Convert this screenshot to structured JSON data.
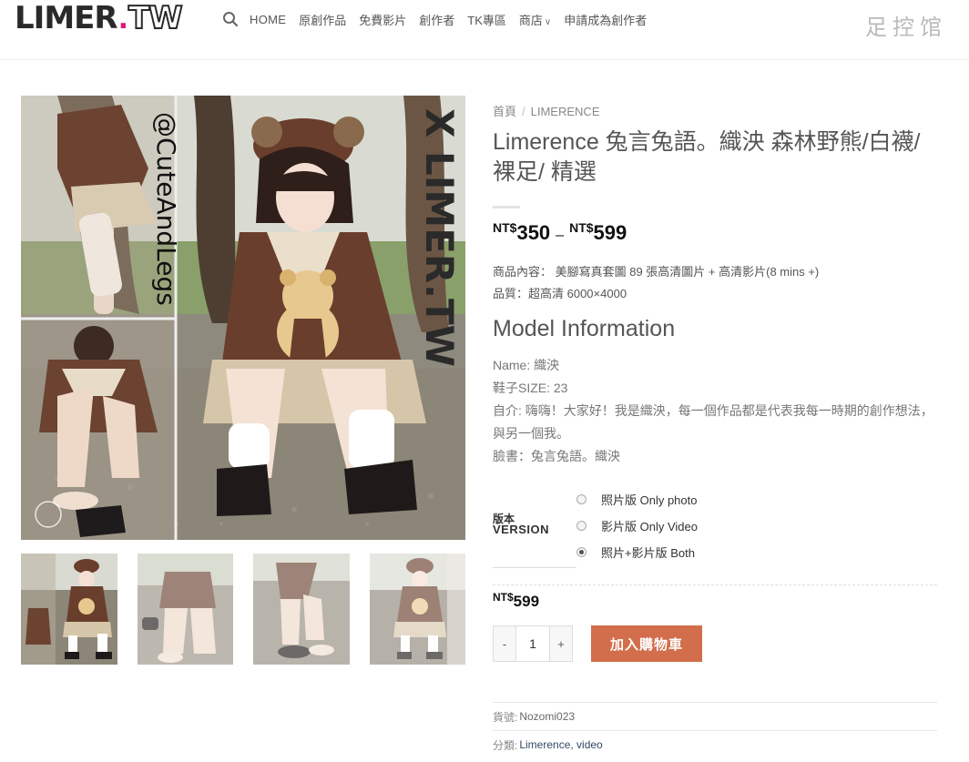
{
  "header": {
    "logo_left": "LIMER",
    "logo_dot": ".",
    "logo_right": "TW",
    "nav": [
      "HOME",
      "原創作品",
      "免費影片",
      "創作者",
      "TK專區",
      "商店",
      "申請成為創作者"
    ],
    "shop_chevron": "chevron-down-icon",
    "brand_right": "足控馆"
  },
  "gallery": {
    "main_overlay_handle": "@CuteAndLegs",
    "main_overlay_watermark": "X LIMER.TW",
    "thumbnail_count": 4
  },
  "product": {
    "breadcrumb": [
      "首頁",
      "LIMERENCE"
    ],
    "breadcrumb_sep": "/",
    "title": "Limerence 兔言兔語。織泱 森林野熊/白襪/裸足/ 精選",
    "price_min_currency": "NT$",
    "price_min": "350",
    "price_dash": "–",
    "price_max_currency": "NT$",
    "price_max": "599",
    "desc_line1": "商品內容： 美腳寫真套圖 89 張高清圖片 + 高清影片(8 mins +)",
    "desc_line2": "品質：超高清 6000×4000",
    "model_heading": "Model Information",
    "model_name": "Name: 織泱",
    "model_shoe": "鞋子SIZE: 23",
    "model_intro": "自介: 嗨嗨！大家好！我是織泱，每一個作品都是代表我每一時期的創作想法，與另一個我。",
    "model_facebook": "臉書：兔言兔語。織泱"
  },
  "variation": {
    "label_top": "版本",
    "label_bottom": "VERSION",
    "options": [
      "照片版 Only photo",
      "影片版 Only Video",
      "照片+影片版 Both"
    ],
    "selected_index": 2
  },
  "selected_price": {
    "currency": "NT$",
    "value": "599"
  },
  "cart": {
    "minus": "-",
    "quantity": "1",
    "plus": "+",
    "add_label": "加入購物車"
  },
  "meta": {
    "sku_label": "貨號:",
    "sku_value": "Nozomi023",
    "category_label": "分類:",
    "category_value": "Limerence, video"
  },
  "colors": {
    "accent_button": "#d26e4b",
    "logo_dot": "#e0157b"
  }
}
